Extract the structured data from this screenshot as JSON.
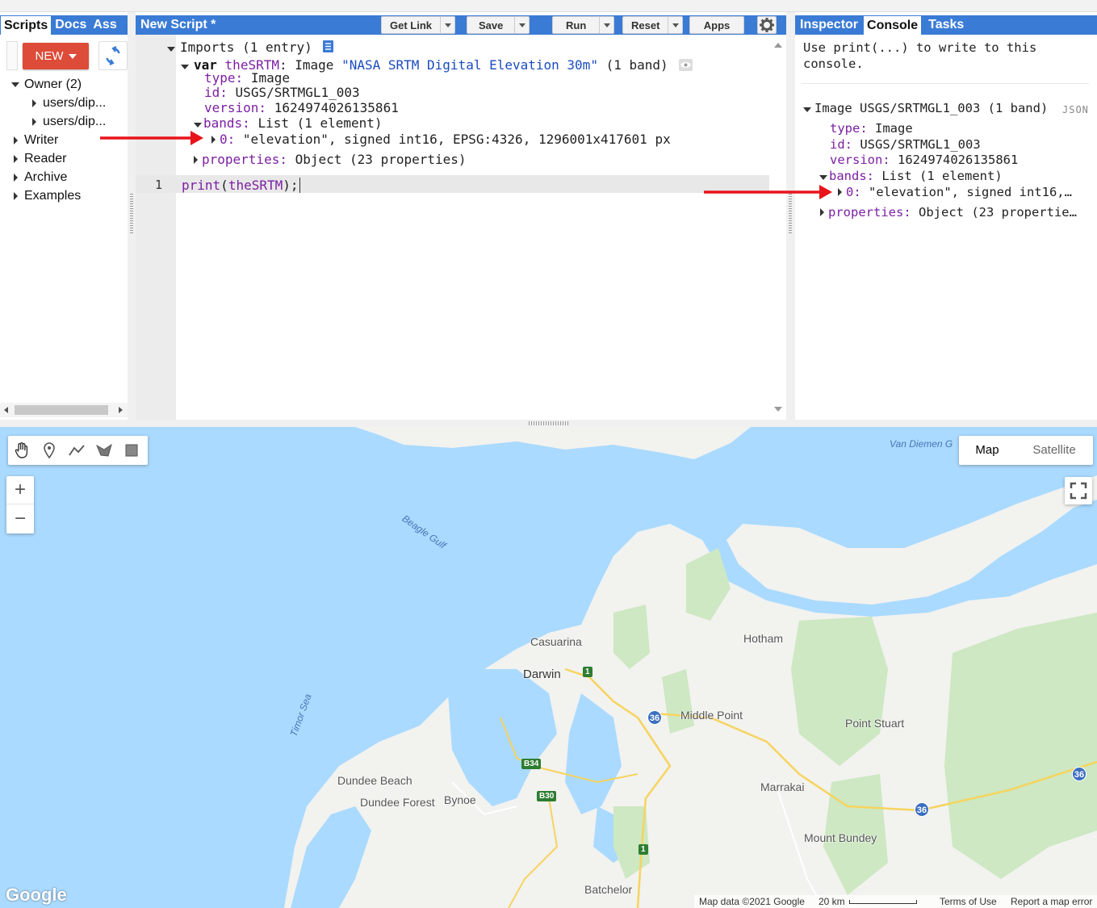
{
  "left_panel": {
    "tabs": [
      "Scripts",
      "Docs",
      "Ass"
    ],
    "active_tab": "Scripts",
    "new_button_label": "NEW",
    "tree": [
      {
        "label": "Owner (2)",
        "expanded": true,
        "children": [
          "users/dip...",
          "users/dip..."
        ]
      },
      {
        "label": "Writer"
      },
      {
        "label": "Reader"
      },
      {
        "label": "Archive"
      },
      {
        "label": "Examples"
      }
    ]
  },
  "editor": {
    "title": "New Script *",
    "buttons": {
      "get_link": "Get Link",
      "save": "Save",
      "run": "Run",
      "reset": "Reset",
      "apps": "Apps"
    },
    "imports": {
      "header": "Imports (1 entry)",
      "var_kw": "var",
      "var_name": "theSRTM",
      "var_type": ": Image",
      "var_desc": "\"NASA SRTM Digital Elevation 30m\"",
      "var_bands": "(1 band)",
      "type_key": "type:",
      "type_val": "Image",
      "id_key": "id:",
      "id_val": "USGS/SRTMGL1_003",
      "version_key": "version:",
      "version_val": "1624974026135861",
      "bands_key": "bands:",
      "bands_val": "List (1 element)",
      "band0_key": "0:",
      "band0_val": "\"elevation\", signed int16, EPSG:4326, 1296001x417601 px",
      "properties_key": "properties:",
      "properties_val": "Object (23 properties)"
    },
    "line_number": "1",
    "code_fn": "print",
    "code_arg": "theSRTM",
    "code_end": ");"
  },
  "right_panel": {
    "tabs": [
      "Inspector",
      "Console",
      "Tasks"
    ],
    "active_tab": "Console",
    "hint_line1": "Use print(...) to write to this",
    "hint_line2": "console.",
    "json_label": "JSON",
    "output": {
      "header": "Image USGS/SRTMGL1_003 (1 band)",
      "type_key": "type:",
      "type_val": "Image",
      "id_key": "id:",
      "id_val": "USGS/SRTMGL1_003",
      "version_key": "version:",
      "version_val": "1624974026135861",
      "bands_key": "bands:",
      "bands_val": "List (1 element)",
      "band0_key": "0:",
      "band0_val": "\"elevation\", signed int16,…",
      "properties_key": "properties:",
      "properties_val": "Object (23 propertie…"
    }
  },
  "map": {
    "map_type_buttons": [
      "Map",
      "Satellite"
    ],
    "active_map_type": "Map",
    "zoom_in": "+",
    "zoom_out": "−",
    "places": {
      "casuarina": "Casuarina",
      "darwin": "Darwin",
      "hotham": "Hotham",
      "middle_point": "Middle Point",
      "point_stuart": "Point Stuart",
      "dundee_beach": "Dundee Beach",
      "dundee_forest": "Dundee Forest",
      "bynoe": "Bynoe",
      "marrakai": "Marrakai",
      "mount_bundey": "Mount Bundey",
      "batchelor": "Batchelor"
    },
    "water": {
      "beagle_gulf": "Beagle Gulf",
      "timor_sea": "Timor Sea",
      "van_diemen": "Van Diemen G"
    },
    "road_shields": {
      "r1a": "1",
      "r1b": "1",
      "r36a": "36",
      "r36b": "36",
      "r36c": "36",
      "b34": "B34",
      "b30": "B30"
    },
    "google_logo": "Google",
    "attribution": {
      "map_data": "Map data ©2021 Google",
      "scale": "20 km",
      "terms": "Terms of Use",
      "report": "Report a map error"
    }
  },
  "colors": {
    "accent_blue": "#3a7bd5",
    "new_button_red": "#dd4b39",
    "annotation_arrow": "#e8141a",
    "water": "#aadaff",
    "land": "#f2f2ef",
    "park": "#cde8c2"
  }
}
